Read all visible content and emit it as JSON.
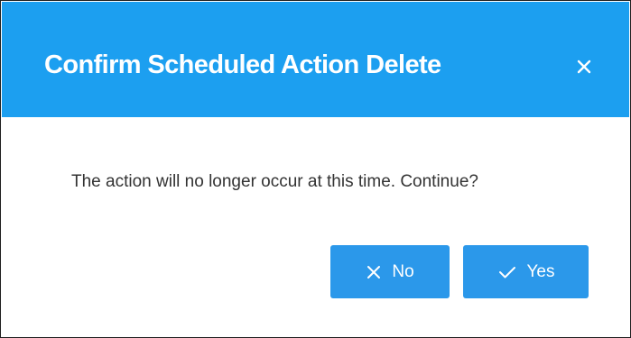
{
  "dialog": {
    "title": "Confirm Scheduled Action Delete",
    "close_icon": "close-icon",
    "message": "The action will no longer occur at this time. Continue?",
    "buttons": {
      "no_label": "No",
      "no_icon": "x-icon",
      "yes_label": "Yes",
      "yes_icon": "check-icon"
    },
    "colors": {
      "header_bg": "#1c9ff0",
      "button_bg": "#2b98ea",
      "text": "#333333"
    }
  }
}
